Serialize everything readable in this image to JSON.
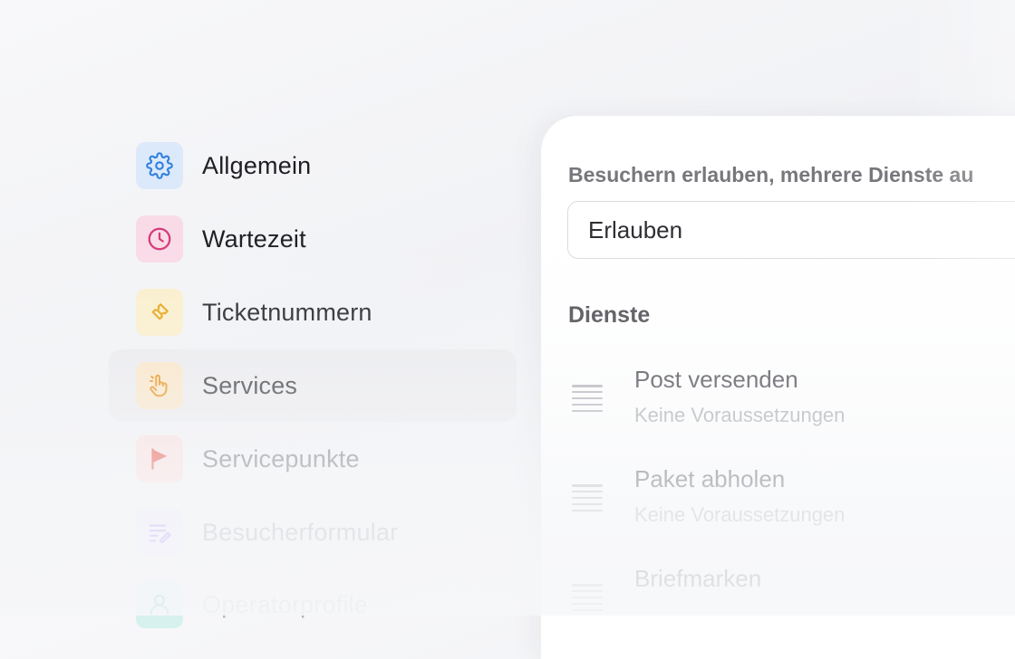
{
  "colors": {
    "general_icon": "#2f7fe0",
    "general_tile": "#dce9fa",
    "waiting_icon": "#d6397a",
    "waiting_tile": "#f9dbe7",
    "ticket_icon": "#e5a412",
    "ticket_tile": "#fbefcc",
    "services_icon": "#e8931c",
    "services_tile": "#fae6c9",
    "servicepoint_icon": "#e8463b",
    "servicepoint_tile": "#fbdedd",
    "form_icon": "#9c7cf0",
    "form_tile": "#ece6fd",
    "operator_icon": "#1fa59a",
    "operator_tile": "#d6f1ee"
  },
  "sidebar": {
    "items": [
      {
        "label": "Allgemein",
        "icon": "gear-icon"
      },
      {
        "label": "Wartezeit",
        "icon": "clock-icon"
      },
      {
        "label": "Ticketnummern",
        "icon": "ticket-icon"
      },
      {
        "label": "Services",
        "icon": "pointing-hand-icon",
        "active": true
      },
      {
        "label": "Servicepunkte",
        "icon": "flag-icon"
      },
      {
        "label": "Besucherformular",
        "icon": "form-edit-icon"
      },
      {
        "label": "Operatorprofile",
        "icon": "user-icon"
      }
    ]
  },
  "settings": {
    "multi_service_label": "Besuchern erlauben, mehrere Dienste au",
    "multi_service_value": "Erlauben",
    "services_title": "Dienste",
    "services": [
      {
        "name": "Post versenden",
        "requirement": "Keine Voraussetzungen"
      },
      {
        "name": "Paket abholen",
        "requirement": "Keine Voraussetzungen"
      },
      {
        "name": "Briefmarken",
        "requirement": ""
      }
    ]
  }
}
